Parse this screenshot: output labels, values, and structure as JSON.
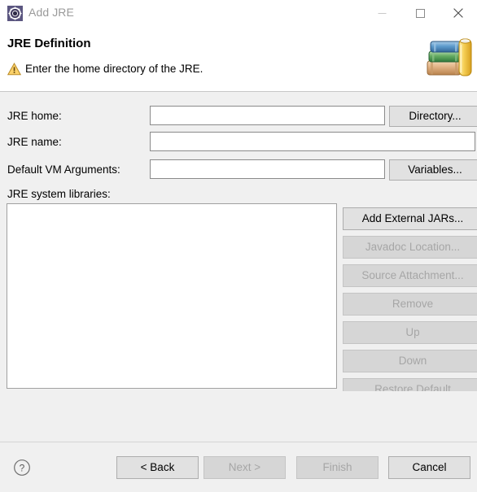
{
  "window": {
    "title": "Add JRE",
    "icon": "jre-gear-icon",
    "controls": {
      "minimize": "minimize-icon",
      "maximize": "maximize-icon",
      "close": "close-icon"
    }
  },
  "header": {
    "title": "JRE Definition",
    "message": "Enter the home directory of the JRE.",
    "status_icon": "warning-triangle-icon",
    "banner_icon": "books-icon"
  },
  "form": {
    "jre_home": {
      "label": "JRE home:",
      "value": "",
      "placeholder": "",
      "button": "Directory..."
    },
    "jre_name": {
      "label": "JRE name:",
      "value": "",
      "placeholder": ""
    },
    "default_vm_arguments": {
      "label": "Default VM Arguments:",
      "value": "",
      "placeholder": "",
      "button": "Variables..."
    },
    "system_libraries": {
      "label": "JRE system libraries:",
      "items": []
    }
  },
  "side_buttons": [
    {
      "label": "Add External JARs...",
      "enabled": true
    },
    {
      "label": "Javadoc Location...",
      "enabled": false
    },
    {
      "label": "Source Attachment...",
      "enabled": false
    },
    {
      "label": "Remove",
      "enabled": false
    },
    {
      "label": "Up",
      "enabled": false
    },
    {
      "label": "Down",
      "enabled": false
    },
    {
      "label": "Restore Default",
      "enabled": false
    }
  ],
  "footer": {
    "help_icon": "help-question-icon",
    "buttons": [
      {
        "label": "< Back",
        "enabled": true
      },
      {
        "label": "Next >",
        "enabled": false
      },
      {
        "label": "Finish",
        "enabled": false
      },
      {
        "label": "Cancel",
        "enabled": true
      }
    ]
  },
  "colors": {
    "titlebar_bg": "#ffffff",
    "title_text": "#9a9a9a",
    "header_bg": "#ffffff",
    "body_bg": "#f0f0f0",
    "button_bg": "#e1e1e1",
    "button_border": "#adadad",
    "disabled_text": "#a6a6a6",
    "input_bg": "#ffffff",
    "input_border": "#8a8a8a",
    "warning_yellow": "#ffcc33"
  }
}
